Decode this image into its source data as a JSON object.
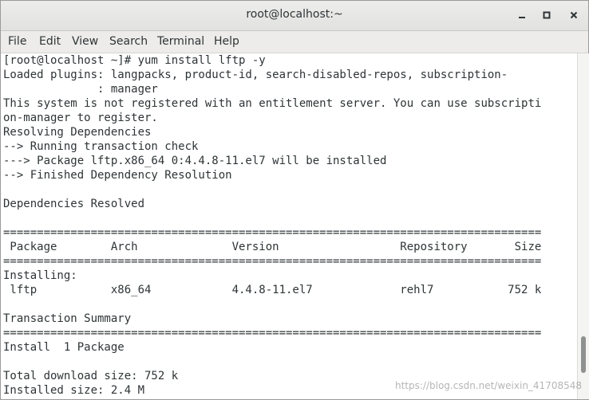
{
  "window": {
    "title": "root@localhost:~",
    "controls": [
      "minimize-icon",
      "maximize-icon",
      "close-icon"
    ]
  },
  "menubar": {
    "items": [
      "File",
      "Edit",
      "View",
      "Search",
      "Terminal",
      "Help"
    ]
  },
  "terminal": {
    "lines": [
      "[root@localhost ~]# yum install lftp -y",
      "Loaded plugins: langpacks, product-id, search-disabled-repos, subscription-",
      "              : manager",
      "This system is not registered with an entitlement server. You can use subscripti",
      "on-manager to register.",
      "Resolving Dependencies",
      "--> Running transaction check",
      "---> Package lftp.x86_64 0:4.4.8-11.el7 will be installed",
      "--> Finished Dependency Resolution",
      "",
      "Dependencies Resolved",
      "",
      "================================================================================",
      " Package        Arch              Version                  Repository       Size",
      "================================================================================",
      "Installing:",
      " lftp           x86_64            4.4.8-11.el7             rehl7           752 k",
      "",
      "Transaction Summary",
      "================================================================================",
      "Install  1 Package",
      "",
      "Total download size: 752 k",
      "Installed size: 2.4 M"
    ]
  },
  "scrollbar": {
    "position": 0.92
  },
  "watermark": "https://blog.csdn.net/weixin_41708548",
  "colors": {
    "text": "#2e3436",
    "background": "#ffffff",
    "titlebar": "#e6e6e5"
  }
}
